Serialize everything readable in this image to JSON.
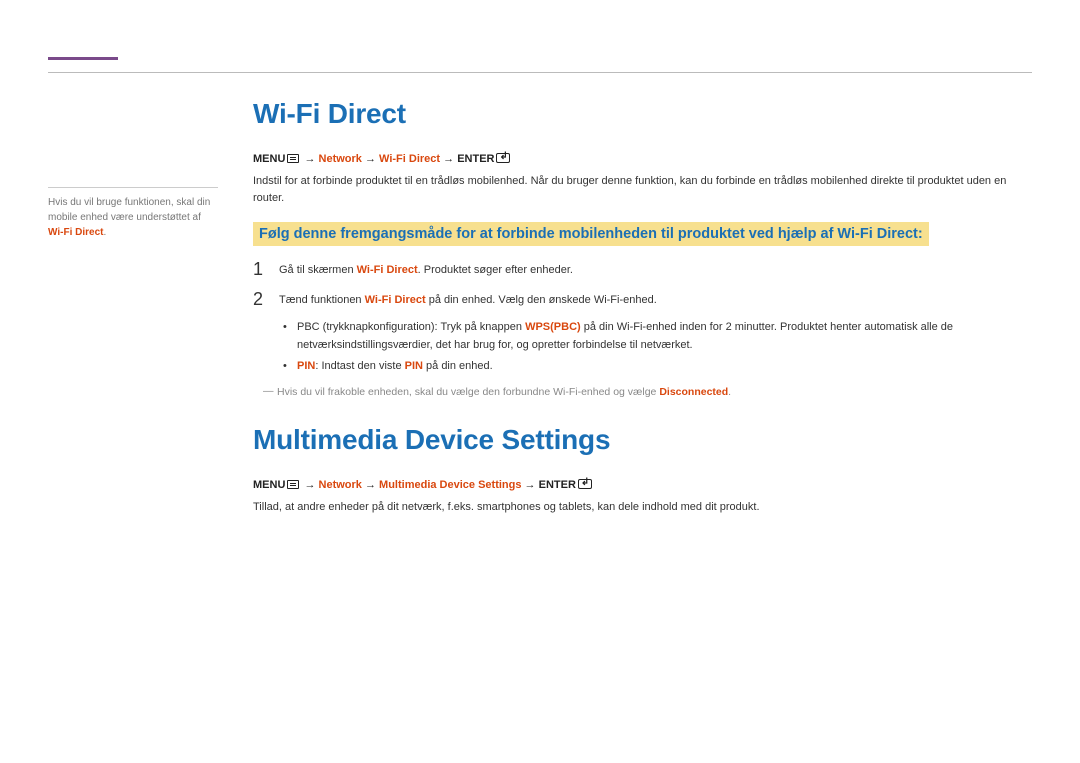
{
  "sidebar": {
    "note_prefix": "Hvis du vil bruge funktionen, skal din mobile enhed være understøttet af ",
    "note_hl": "Wi-Fi Direct",
    "note_suffix": "."
  },
  "section1": {
    "title": "Wi-Fi Direct",
    "menu": {
      "menu_label": "MENU",
      "arrow": " → ",
      "p1": "Network",
      "p2": "Wi-Fi Direct",
      "enter_label": "ENTER"
    },
    "intro": "Indstil for at forbinde produktet til en trådløs mobilenhed. Når du bruger denne funktion, kan du forbinde en trådløs mobilenhed direkte til produktet uden en router.",
    "highlight": "Følg denne fremgangsmåde for at forbinde mobilenheden til produktet ved hjælp af Wi-Fi Direct:",
    "step1": {
      "num": "1",
      "pre": "Gå til skærmen ",
      "hl": "Wi-Fi Direct",
      "post": ". Produktet søger efter enheder."
    },
    "step2": {
      "num": "2",
      "pre": "Tænd funktionen ",
      "hl": "Wi-Fi Direct",
      "post": " på din enhed. Vælg den ønskede Wi-Fi-enhed."
    },
    "bullet1": {
      "pre": "PBC (trykknapkonfiguration): Tryk på knappen ",
      "hl": "WPS(PBC)",
      "post": " på din Wi-Fi-enhed inden for 2 minutter. Produktet henter automatisk alle de netværksindstillingsværdier, det har brug for, og opretter forbindelse til netværket."
    },
    "bullet2": {
      "hl1": "PIN",
      "mid": ": Indtast den viste ",
      "hl2": "PIN",
      "post": " på din enhed."
    },
    "footnote": {
      "pre": "Hvis du vil frakoble enheden, skal du vælge den forbundne Wi-Fi-enhed og vælge ",
      "hl": "Disconnected",
      "post": "."
    }
  },
  "section2": {
    "title": "Multimedia Device Settings",
    "menu": {
      "menu_label": "MENU",
      "arrow": " → ",
      "p1": "Network",
      "p2": "Multimedia Device Settings",
      "enter_label": "ENTER"
    },
    "intro": "Tillad, at andre enheder på dit netværk, f.eks. smartphones og tablets, kan dele indhold med dit produkt."
  }
}
